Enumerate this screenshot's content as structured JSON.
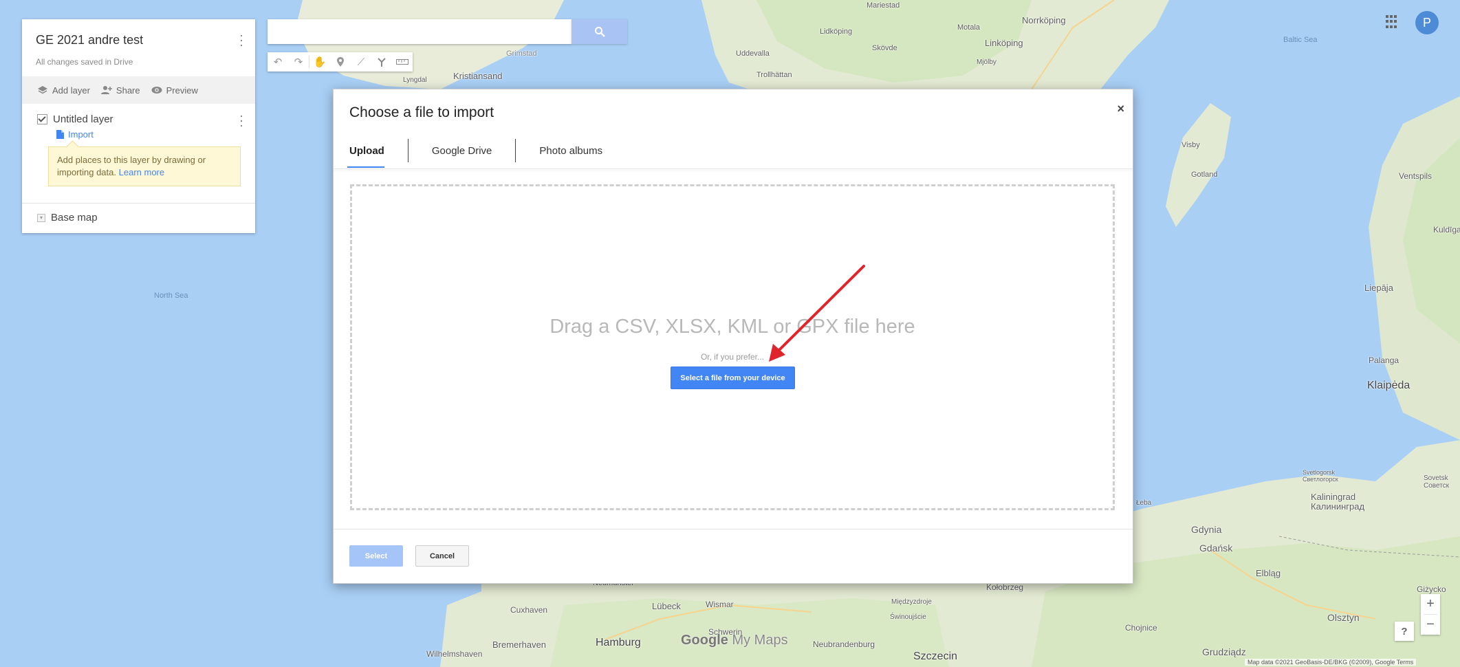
{
  "colors": {
    "accent": "#4285f4",
    "annotation_arrow": "#e0242b",
    "water": "#a9cff5",
    "land": "#e8ecd9",
    "forest": "#cfe5b8"
  },
  "panel": {
    "title": "GE 2021 andre test",
    "save_status": "All changes saved in Drive",
    "actions": {
      "add_layer": "Add layer",
      "share": "Share",
      "preview": "Preview"
    },
    "layer": {
      "name": "Untitled layer",
      "import_label": "Import",
      "hint_text": "Add places to this layer by drawing or importing data.",
      "hint_link": "Learn more"
    },
    "basemap_label": "Base map"
  },
  "search": {
    "value": "",
    "placeholder": ""
  },
  "toolbar": {
    "icons": [
      "undo-icon",
      "redo-icon",
      "hand-icon",
      "marker-icon",
      "draw-line-icon",
      "directions-icon",
      "ruler-icon"
    ]
  },
  "user": {
    "avatar_letter": "P"
  },
  "dialog": {
    "title": "Choose a file to import",
    "close": "×",
    "tabs": [
      "Upload",
      "Google Drive",
      "Photo albums"
    ],
    "active_tab": "Upload",
    "drag_text": "Drag a CSV, XLSX, KML or GPX file here",
    "or_text": "Or, if you prefer...",
    "select_device_button": "Select a file from your device",
    "select_button": "Select",
    "cancel_button": "Cancel"
  },
  "map": {
    "labels": {
      "north_sea": "North Sea",
      "baltic_sea": "Baltic Sea",
      "kristiansand": "Kristiansand",
      "lyngdal": "Lyngdal",
      "grimstad": "Grimstad",
      "uddevalla": "Uddevalla",
      "trollhattan": "Trollhättan",
      "lidkoping": "Lidköping",
      "skovde": "Skövde",
      "mariestad": "Mariestad",
      "motala": "Motala",
      "norrkoping": "Norrköping",
      "linkoping": "Linköping",
      "mjolby": "Mjölby",
      "visby": "Visby",
      "gotland": "Gotland",
      "ventspils": "Ventspils",
      "kuldiga": "Kuldīga",
      "liepaja": "Liepāja",
      "palanga": "Palanga",
      "klaipeda": "Klaipėda",
      "svetlogorsk": "Svetlogorsk\nСветлогорск",
      "sovetsk": "Sovetsk\nСоветск",
      "kaliningrad": "Kaliningrad\nКалининград",
      "gdynia": "Gdynia",
      "gdansk": "Gdańsk",
      "elblag": "Elbląg",
      "gizycko": "Giżycko",
      "olsztyn": "Olsztyn",
      "grudziadz": "Grudziądz",
      "chojnice": "Chojnice",
      "kolobrzeg": "Kołobrzeg",
      "miedzyzdroje": "Międzyzdroje",
      "swinoujscie": "Świnoujście",
      "szczecin": "Szczecin",
      "neubrandenburg": "Neubrandenburg",
      "schwerin": "Schwerin",
      "hamburg": "Hamburg",
      "lubeck": "Lübeck",
      "wismar": "Wismar",
      "cuxhaven": "Cuxhaven",
      "bremerhaven": "Bremerhaven",
      "wilhelmshaven": "Wilhelmshaven",
      "neumunster": "Neumünster",
      "leba": "Łeba"
    },
    "logo_google": "Google",
    "logo_product": " My Maps",
    "attribution": "Map data ©2021 GeoBasis-DE/BKG (©2009), Google   Terms"
  },
  "zoom": {
    "plus": "+",
    "minus": "−",
    "help": "?"
  }
}
